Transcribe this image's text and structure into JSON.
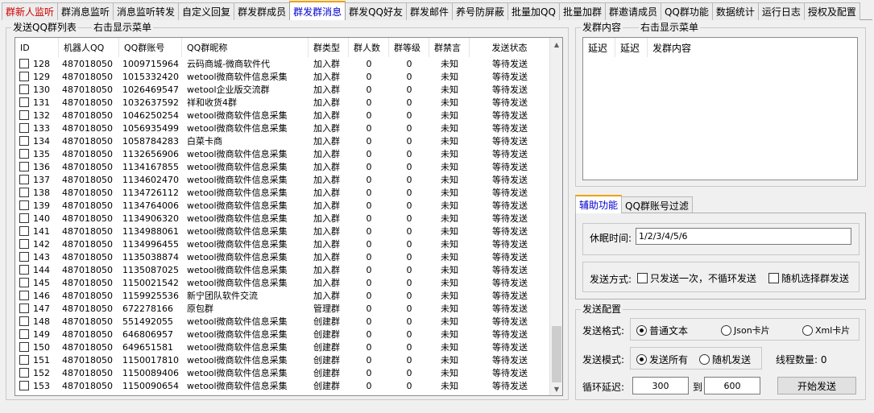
{
  "tabs": [
    {
      "label": "群新人监听",
      "red": true
    },
    {
      "label": "群消息监听"
    },
    {
      "label": "消息监听转发"
    },
    {
      "label": "自定义回复"
    },
    {
      "label": "群发群成员"
    },
    {
      "label": "群发群消息",
      "active": true
    },
    {
      "label": "群发QQ好友"
    },
    {
      "label": "群发邮件"
    },
    {
      "label": "养号防屏蔽"
    },
    {
      "label": "批量加QQ"
    },
    {
      "label": "批量加群"
    },
    {
      "label": "群邀请成员"
    },
    {
      "label": "QQ群功能"
    },
    {
      "label": "数据统计"
    },
    {
      "label": "运行日志"
    },
    {
      "label": "授权及配置"
    }
  ],
  "group_list": {
    "title": "发送QQ群列表",
    "hint": "右击显示菜单",
    "columns": [
      "ID",
      "机器人QQ",
      "QQ群账号",
      "QQ群昵称",
      "群类型",
      "群人数",
      "群等级",
      "群禁言",
      "发送状态"
    ],
    "rows": [
      [
        "128",
        "487018050",
        "1009715964",
        "云码商城-微商软件代",
        "加入群",
        "0",
        "0",
        "未知",
        "等待发送"
      ],
      [
        "129",
        "487018050",
        "1015332420",
        "wetool微商软件信息采集",
        "加入群",
        "0",
        "0",
        "未知",
        "等待发送"
      ],
      [
        "130",
        "487018050",
        "1026469547",
        "wetool企业版交流群",
        "加入群",
        "0",
        "0",
        "未知",
        "等待发送"
      ],
      [
        "131",
        "487018050",
        "1032637592",
        "祥和收货4群",
        "加入群",
        "0",
        "0",
        "未知",
        "等待发送"
      ],
      [
        "132",
        "487018050",
        "1046250254",
        "wetool微商软件信息采集",
        "加入群",
        "0",
        "0",
        "未知",
        "等待发送"
      ],
      [
        "133",
        "487018050",
        "1056935499",
        "wetool微商软件信息采集",
        "加入群",
        "0",
        "0",
        "未知",
        "等待发送"
      ],
      [
        "134",
        "487018050",
        "1058784283",
        "白菜卡商",
        "加入群",
        "0",
        "0",
        "未知",
        "等待发送"
      ],
      [
        "135",
        "487018050",
        "1132656906",
        "wetool微商软件信息采集",
        "加入群",
        "0",
        "0",
        "未知",
        "等待发送"
      ],
      [
        "136",
        "487018050",
        "1134167855",
        "wetool微商软件信息采集",
        "加入群",
        "0",
        "0",
        "未知",
        "等待发送"
      ],
      [
        "137",
        "487018050",
        "1134602470",
        "wetool微商软件信息采集",
        "加入群",
        "0",
        "0",
        "未知",
        "等待发送"
      ],
      [
        "138",
        "487018050",
        "1134726112",
        "wetool微商软件信息采集",
        "加入群",
        "0",
        "0",
        "未知",
        "等待发送"
      ],
      [
        "139",
        "487018050",
        "1134764006",
        "wetool微商软件信息采集",
        "加入群",
        "0",
        "0",
        "未知",
        "等待发送"
      ],
      [
        "140",
        "487018050",
        "1134906320",
        "wetool微商软件信息采集",
        "加入群",
        "0",
        "0",
        "未知",
        "等待发送"
      ],
      [
        "141",
        "487018050",
        "1134988061",
        "wetool微商软件信息采集",
        "加入群",
        "0",
        "0",
        "未知",
        "等待发送"
      ],
      [
        "142",
        "487018050",
        "1134996455",
        "wetool微商软件信息采集",
        "加入群",
        "0",
        "0",
        "未知",
        "等待发送"
      ],
      [
        "143",
        "487018050",
        "1135038874",
        "wetool微商软件信息采集",
        "加入群",
        "0",
        "0",
        "未知",
        "等待发送"
      ],
      [
        "144",
        "487018050",
        "1135087025",
        "wetool微商软件信息采集",
        "加入群",
        "0",
        "0",
        "未知",
        "等待发送"
      ],
      [
        "145",
        "487018050",
        "1150021542",
        "wetool微商软件信息采集",
        "加入群",
        "0",
        "0",
        "未知",
        "等待发送"
      ],
      [
        "146",
        "487018050",
        "1159925536",
        "新宁团队软件交流",
        "加入群",
        "0",
        "0",
        "未知",
        "等待发送"
      ],
      [
        "147",
        "487018050",
        "672278166",
        "原包群",
        "管理群",
        "0",
        "0",
        "未知",
        "等待发送"
      ],
      [
        "148",
        "487018050",
        "551492055",
        "wetool微商软件信息采集",
        "创建群",
        "0",
        "0",
        "未知",
        "等待发送"
      ],
      [
        "149",
        "487018050",
        "646806957",
        "wetool微商软件信息采集",
        "创建群",
        "0",
        "0",
        "未知",
        "等待发送"
      ],
      [
        "150",
        "487018050",
        "649651581",
        "wetool微商软件信息采集",
        "创建群",
        "0",
        "0",
        "未知",
        "等待发送"
      ],
      [
        "151",
        "487018050",
        "1150017810",
        "wetool微商软件信息采集",
        "创建群",
        "0",
        "0",
        "未知",
        "等待发送"
      ],
      [
        "152",
        "487018050",
        "1150089406",
        "wetool微商软件信息采集",
        "创建群",
        "0",
        "0",
        "未知",
        "等待发送"
      ],
      [
        "153",
        "487018050",
        "1150090654",
        "wetool微商软件信息采集",
        "创建群",
        "0",
        "0",
        "未知",
        "等待发送"
      ]
    ]
  },
  "send_content": {
    "title": "发群内容",
    "hint": "右击显示菜单",
    "columns": [
      "延迟",
      "延迟",
      "发群内容"
    ]
  },
  "aux_tabs": [
    {
      "label": "辅助功能",
      "active": true
    },
    {
      "label": "QQ群账号过滤"
    }
  ],
  "aux": {
    "sleep_label": "休眠时间:",
    "sleep_value": "1/2/3/4/5/6",
    "send_mode_label": "发送方式:",
    "once_label": "只发送一次，不循环发送",
    "random_group_label": "随机选择群发送"
  },
  "config": {
    "title": "发送配置",
    "format_label": "发送格式:",
    "format_options": [
      "普通文本",
      "Json卡片",
      "Xml卡片"
    ],
    "pattern_label": "发送模式:",
    "pattern_options": [
      "发送所有",
      "随机发送"
    ],
    "thread_label": "线程数量: 0",
    "loop_label": "循环延迟:",
    "loop_from": "300",
    "to_label": "到",
    "loop_to": "600",
    "start_button": "开始发送"
  }
}
